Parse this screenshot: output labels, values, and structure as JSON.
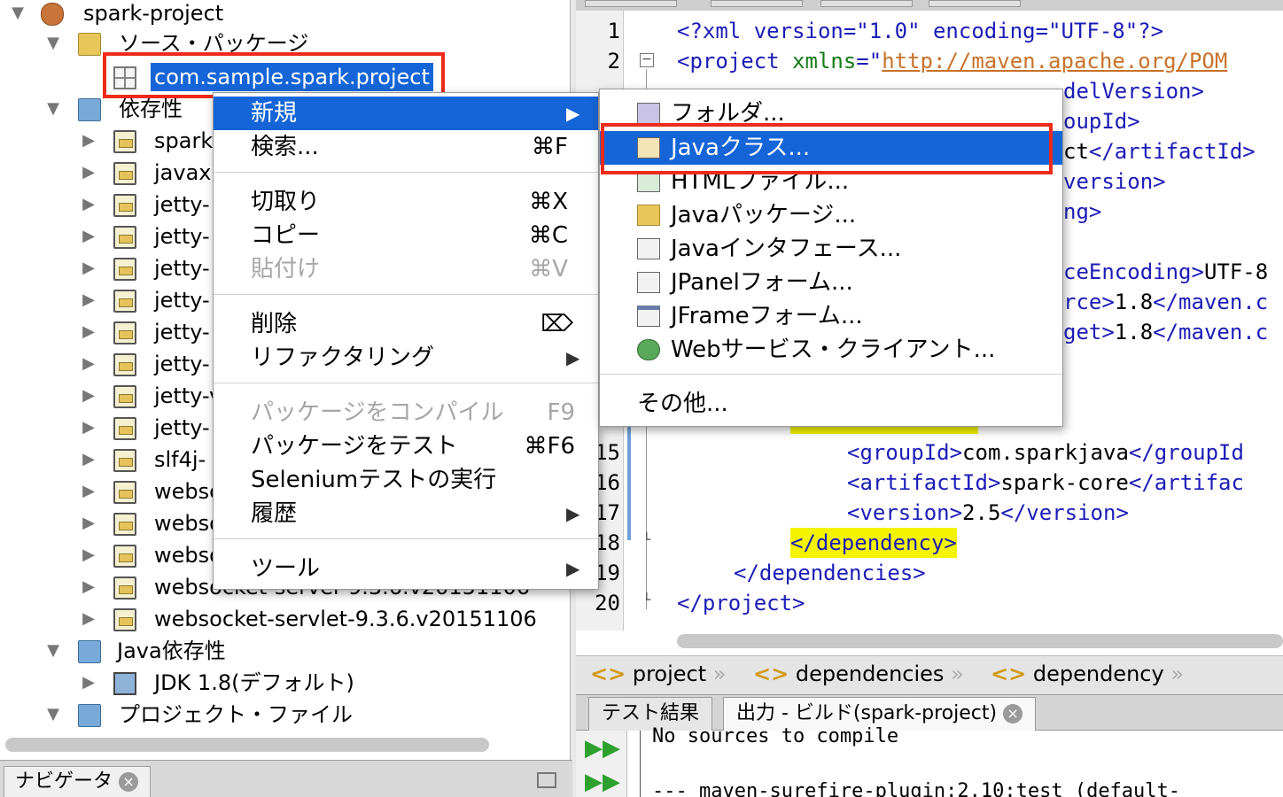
{
  "tree": {
    "project": "spark-project",
    "source_packages": "ソース・パッケージ",
    "package": "com.sample.spark.project",
    "dependencies": "依存性",
    "dep_items": [
      "spark",
      "javax.",
      "jetty-",
      "jetty-",
      "jetty-",
      "jetty-",
      "jetty-",
      "jetty-",
      "jetty-v",
      "jetty-",
      "slf4j-",
      "websc",
      "webso",
      "webso",
      "websocket-server-9.3.6.v20151106",
      "websocket-servlet-9.3.6.v20151106"
    ],
    "java_dependencies": "Java依存性",
    "jdk": "JDK 1.8(デフォルト)",
    "project_files": "プロジェクト・ファイル"
  },
  "navigator": {
    "tab": "ナビゲータ"
  },
  "context_menu": {
    "new": "新規",
    "find": "検索...",
    "find_sc": "⌘F",
    "cut": "切取り",
    "cut_sc": "⌘X",
    "copy": "コピー",
    "copy_sc": "⌘C",
    "paste": "貼付け",
    "paste_sc": "⌘V",
    "delete": "削除",
    "delete_sc": "⌦",
    "refactor": "リファクタリング",
    "compile": "パッケージをコンパイル",
    "compile_sc": "F9",
    "test": "パッケージをテスト",
    "test_sc": "⌘F6",
    "selenium": "Seleniumテストの実行",
    "history": "履歴",
    "tools": "ツール",
    "arrow": "▶"
  },
  "submenu": {
    "folder": "フォルダ...",
    "java_class": "Javaクラス...",
    "html_file": "HTMLファイル...",
    "java_package": "Javaパッケージ...",
    "java_interface": "Javaインタフェース...",
    "jpanel": "JPanelフォーム...",
    "jframe": "JFrameフォーム...",
    "web_client": "Webサービス・クライアント...",
    "other": "その他..."
  },
  "editor": {
    "line_numbers": [
      "1",
      "2",
      "15",
      "16",
      "17",
      "18",
      "19",
      "20"
    ],
    "line1": "<?xml version=\"1.0\" encoding=\"UTF-8\"?>",
    "line2_tag": "<project ",
    "line2_attr": "xmlns",
    "line2_eq": "=\"",
    "line2_url": "http://maven.apache.org/POM",
    "line3_partial": "delVersion>",
    "line4_partial": "oupId>",
    "line5_partial_a": "ct",
    "line5_partial_b": "</artifactId>",
    "line6_partial": "version>",
    "line7_partial": "ng>",
    "line9_a": "ceEncoding>",
    "line9_b": "UTF-8",
    "line10_a": "rce>",
    "line10_b": "1.8",
    "line10_c": "</maven.c",
    "line11_a": "get>",
    "line11_b": "1.8",
    "line11_c": "</maven.c",
    "line15_a": "<groupId>",
    "line15_b": "com.sparkjava",
    "line15_c": "</groupId",
    "line16_a": "<artifactId>",
    "line16_b": "spark-core",
    "line16_c": "</artifac",
    "line17_a": "<version>",
    "line17_b": "2.5",
    "line17_c": "</version>",
    "line18": "</dependency>",
    "line19": "</dependencies>",
    "line20": "</project>"
  },
  "breadcrumb": {
    "items": [
      "project",
      "dependencies",
      "dependency"
    ],
    "glyph": "<>",
    "sep": "»"
  },
  "output": {
    "tab1": "テスト結果",
    "tab2": "出力 - ビルド(spark-project)",
    "line1": "No sources to compile",
    "line2": "--- maven-surefire-plugin:2.10:test (default-"
  }
}
